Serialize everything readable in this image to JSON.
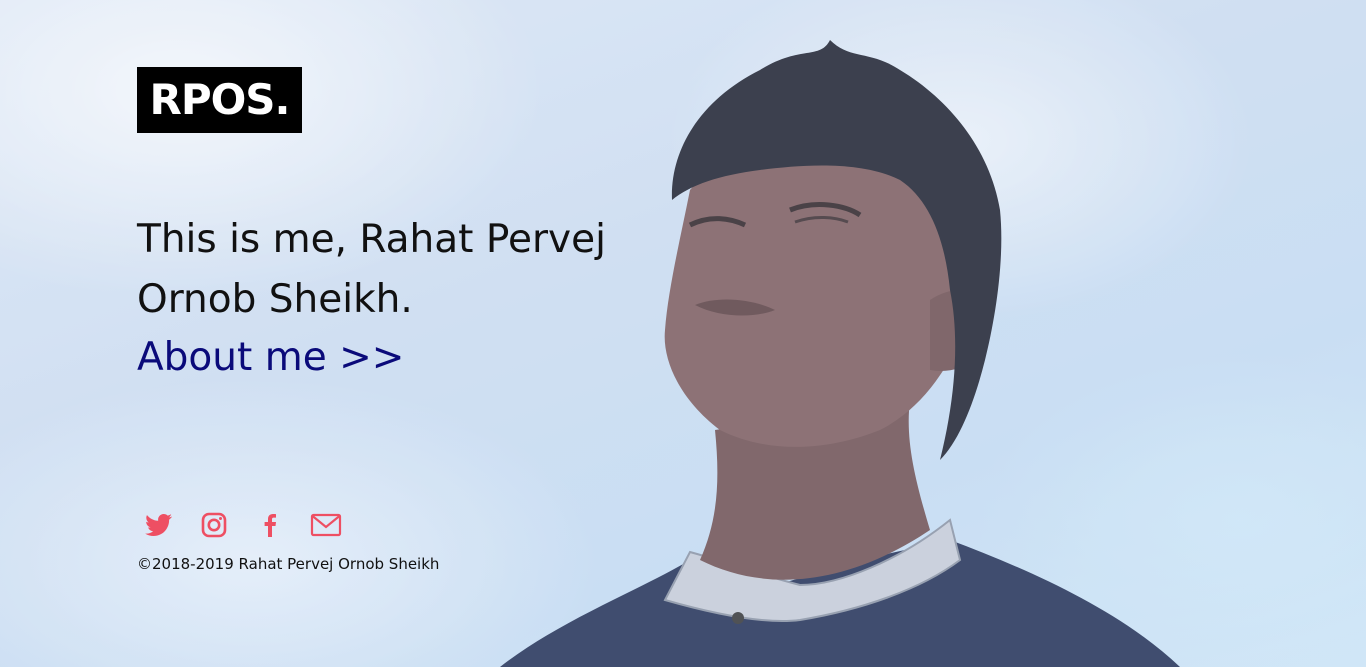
{
  "brand": {
    "logo_text": "RPOS."
  },
  "hero": {
    "headline": "This is me, Rahat Pervej Ornob Sheikh.",
    "about_link": "About me >>"
  },
  "social": {
    "icons": [
      "twitter-icon",
      "instagram-icon",
      "facebook-icon",
      "mail-icon"
    ],
    "accent_color": "#ee4f63"
  },
  "footer": {
    "copyright": "©2018-2019 Rahat Pervej Ornob Sheikh"
  },
  "colors": {
    "link": "#0a0a7a",
    "logo_bg": "#000000",
    "sky": "#cfdff2"
  }
}
